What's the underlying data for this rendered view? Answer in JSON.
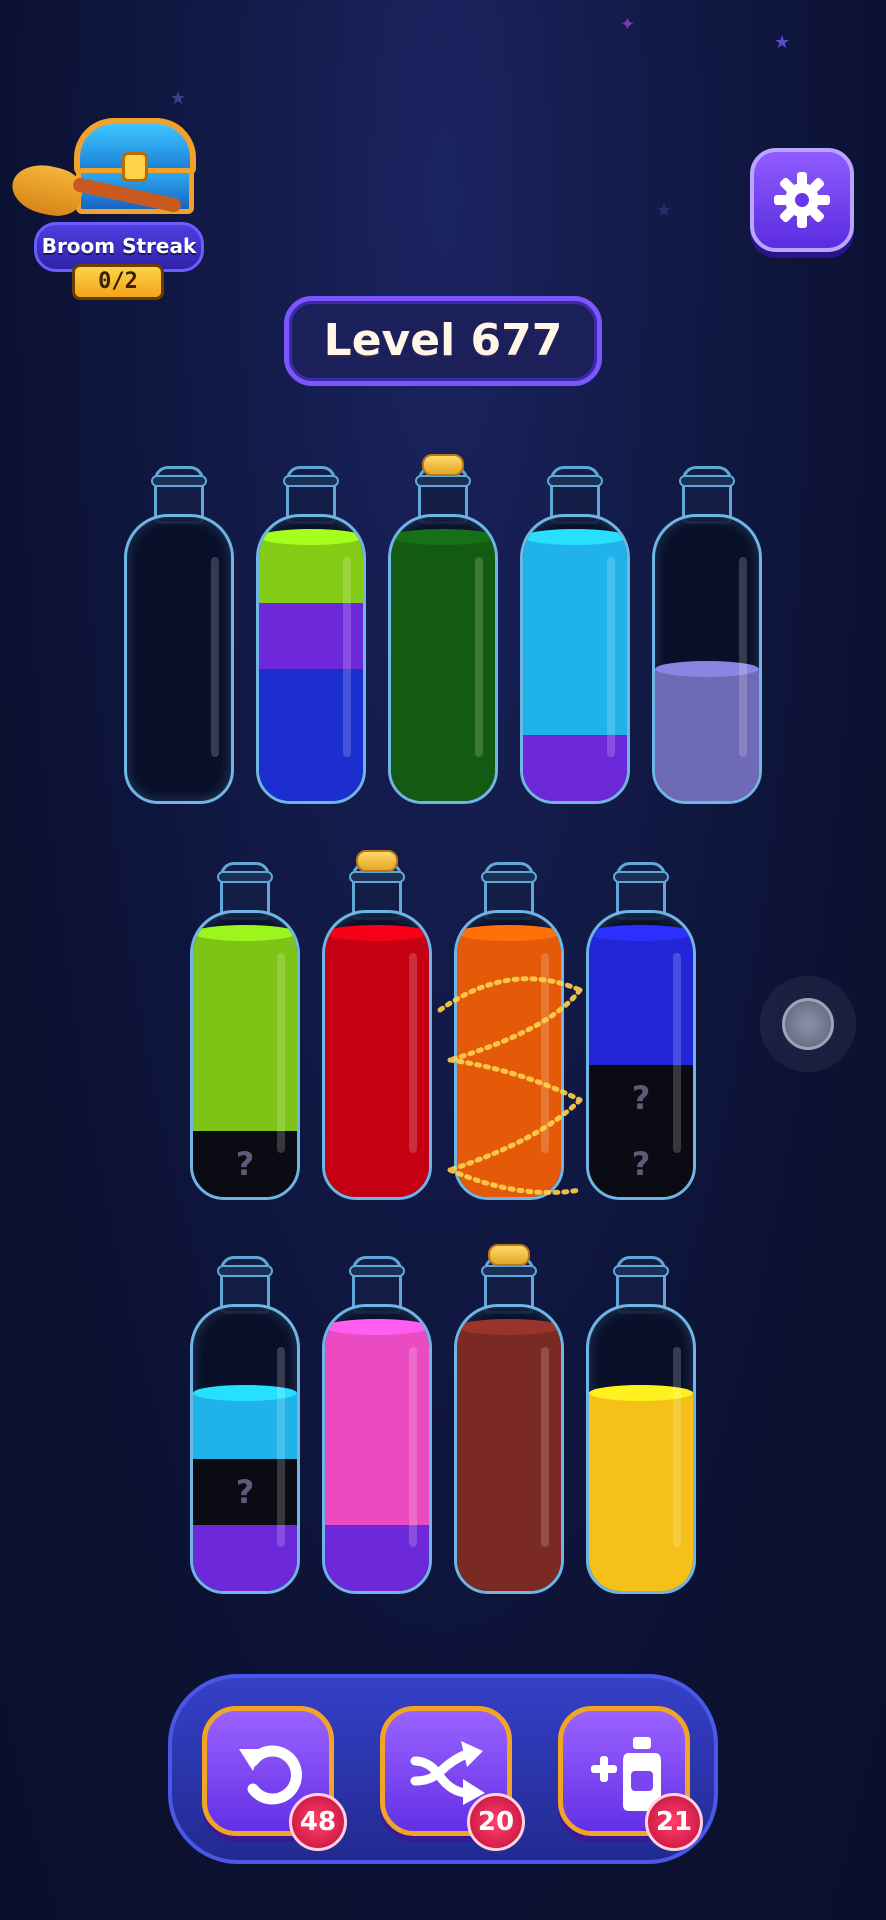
{
  "streak": {
    "label": "Broom Streak",
    "count": "0/2"
  },
  "level": {
    "label": "Level 677"
  },
  "bottles": [
    {
      "segments": []
    },
    {
      "segments": [
        {
          "color": "#84cc16",
          "h": 1
        },
        {
          "color": "#6d28d9",
          "h": 1
        },
        {
          "color": "#1d2ed0",
          "h": 2
        }
      ]
    },
    {
      "corked": true,
      "segments": [
        {
          "color": "#135a12",
          "h": 4
        }
      ]
    },
    {
      "segments": [
        {
          "color": "#1fb3ea",
          "h": 3
        },
        {
          "color": "#6d28d9",
          "h": 1
        }
      ]
    },
    {
      "segments": [
        {
          "color": "#6e6ab5",
          "h": 2
        }
      ]
    },
    {
      "segments": [
        {
          "color": "#7dc417",
          "h": 3
        },
        {
          "color": "#0b0b14",
          "h": 1,
          "hidden": true
        }
      ]
    },
    {
      "corked": true,
      "segments": [
        {
          "color": "#c40012",
          "h": 4
        }
      ]
    },
    {
      "segments": [
        {
          "color": "#e45a08",
          "h": 4
        }
      ]
    },
    {
      "segments": [
        {
          "color": "#2326d6",
          "h": 2
        },
        {
          "color": "#0b0b14",
          "h": 1,
          "hidden": true
        },
        {
          "color": "#0b0b14",
          "h": 1,
          "hidden": true
        }
      ]
    },
    {
      "segments": [
        {
          "color": "#1fb3ea",
          "h": 1
        },
        {
          "color": "#0b0b14",
          "h": 1,
          "hidden": true
        },
        {
          "color": "#6d28d9",
          "h": 1
        }
      ]
    },
    {
      "segments": [
        {
          "color": "#ea4bc0",
          "h": 3
        },
        {
          "color": "#6d28d9",
          "h": 1
        }
      ]
    },
    {
      "corked": true,
      "segments": [
        {
          "color": "#7a2a22",
          "h": 4
        }
      ]
    },
    {
      "segments": [
        {
          "color": "#f5c118",
          "h": 3
        }
      ]
    }
  ],
  "hidden_mark": "?",
  "tools": {
    "undo": {
      "count": "48",
      "icon": "undo-icon"
    },
    "shuffle": {
      "count": "20",
      "icon": "shuffle-icon"
    },
    "add_bottle": {
      "count": "21",
      "icon": "add-bottle-icon"
    }
  },
  "colors": {
    "accent": "#7d55ff",
    "badge": "#e0184c",
    "gold": "#f0a524"
  }
}
